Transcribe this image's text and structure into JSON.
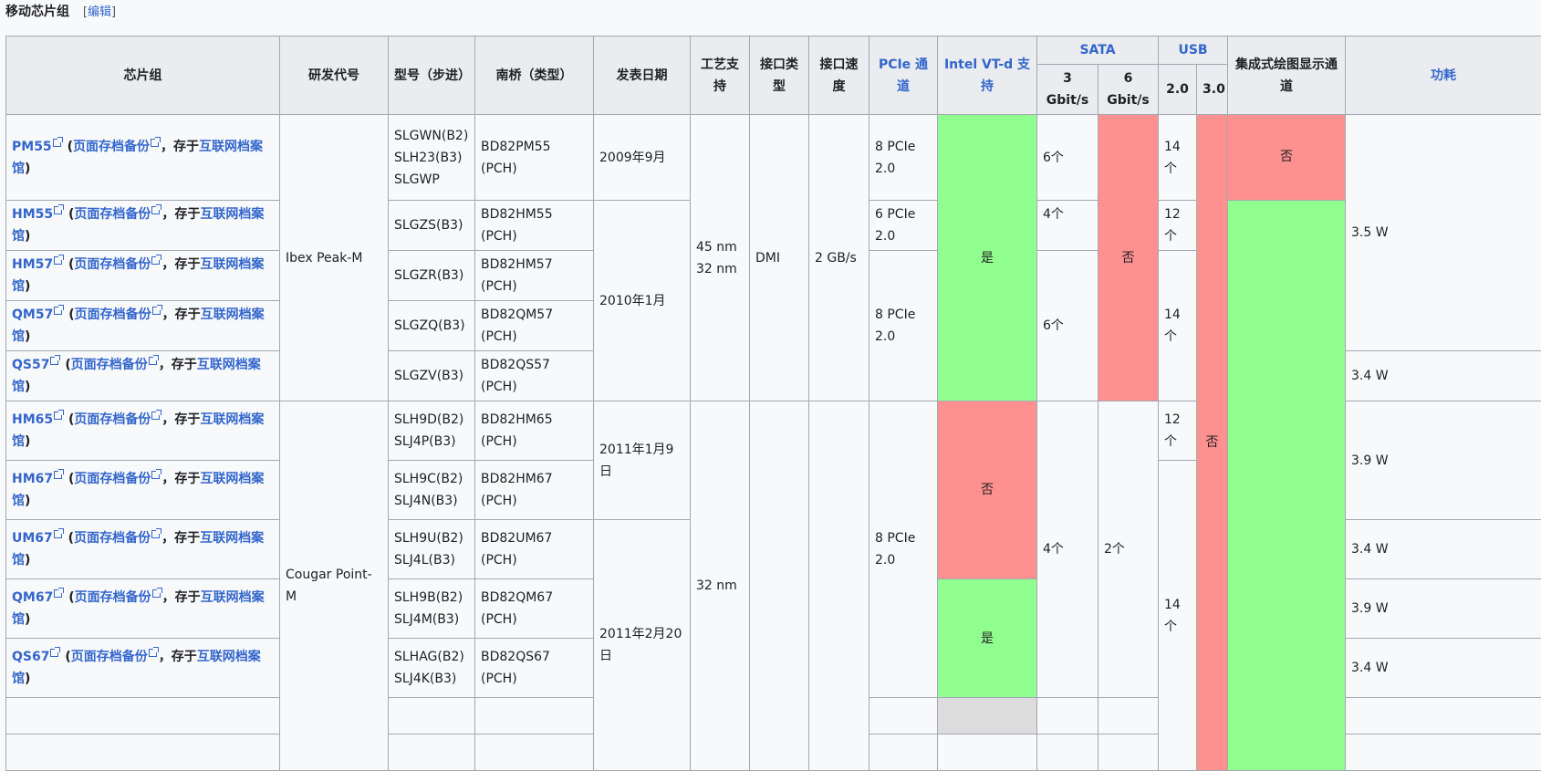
{
  "section": {
    "title": "移动芯片组",
    "edit_open": "[",
    "edit_label": "编辑",
    "edit_close": "]"
  },
  "headers": {
    "chipset": "芯片组",
    "codename": "研发代号",
    "model": "型号（步进）",
    "southbridge": "南桥（类型）",
    "date": "发表日期",
    "process": "工艺支持",
    "interface": "接口类型",
    "speed": "接口速度",
    "pcie": "PCIe 通道",
    "vtd": "Intel VT-d 支持",
    "sata": "SATA",
    "usb": "USB",
    "igp": "集成式绘图显示通道",
    "tdp": "功耗",
    "sata3": "3 Gbit/s",
    "sata6": "6 Gbit/s",
    "usb2": "2.0",
    "usb3": "3.0"
  },
  "common": {
    "archive": "页面存档备份",
    "sep": "，存于",
    "archive2": "互联网档案馆",
    "open": "(",
    "close": ")"
  },
  "rows": [
    {
      "name": "PM55",
      "steps": [
        "SLGWN(B2)",
        "SLH23(B3)",
        "SLGWP"
      ],
      "sb": "BD82PM55 (PCH)"
    },
    {
      "name": "HM55",
      "steps": [
        "SLGZS(B3)"
      ],
      "sb": "BD82HM55 (PCH)"
    },
    {
      "name": "HM57",
      "steps": [
        "SLGZR(B3)"
      ],
      "sb": "BD82HM57 (PCH)"
    },
    {
      "name": "QM57",
      "steps": [
        "SLGZQ(B3)"
      ],
      "sb": "BD82QM57 (PCH)"
    },
    {
      "name": "QS57",
      "steps": [
        "SLGZV(B3)"
      ],
      "sb": "BD82QS57 (PCH)"
    },
    {
      "name": "HM65",
      "steps": [
        "SLH9D(B2)",
        "SLJ4P(B3)"
      ],
      "sb": "BD82HM65 (PCH)"
    },
    {
      "name": "HM67",
      "steps": [
        "SLH9C(B2)",
        "SLJ4N(B3)"
      ],
      "sb": "BD82HM67 (PCH)"
    },
    {
      "name": "UM67",
      "steps": [
        "SLH9U(B2)",
        "SLJ4L(B3)"
      ],
      "sb": "BD82UM67 (PCH)"
    },
    {
      "name": "QM67",
      "steps": [
        "SLH9B(B2)",
        "SLJ4M(B3)"
      ],
      "sb": "BD82QM67 (PCH)"
    },
    {
      "name": "QS67",
      "steps": [
        "SLHAG(B2)",
        "SLJ4K(B3)"
      ],
      "sb": "BD82QS67 (PCH)"
    }
  ],
  "cells": {
    "ibex": "Ibex Peak-M",
    "cougar": "Cougar Point-M",
    "d2009": "2009年9月",
    "d2010": "2010年1月",
    "d2011a": "2011年1月9日",
    "d2011b": "2011年2月20日",
    "proc45": "45 nm",
    "proc32a": "32 nm",
    "proc32b": "32 nm",
    "dmi": "DMI",
    "gbs": "2 GB/s",
    "pcie8a": "8 PCIe 2.0",
    "pcie6": "6 PCIe 2.0",
    "pcie8b": "8 PCIe 2.0",
    "pcie8c": "8 PCIe 2.0",
    "yes": "是",
    "no": "否",
    "s6a": "6个",
    "s4a": "4个",
    "s6b": "6个",
    "s4b": "4个",
    "s2": "2个",
    "u14a": "14 个",
    "u12a": "12 个",
    "u14b": "14 个",
    "u12b": "12 个",
    "u14c": "14 个",
    "w35": "3.5 W",
    "w34a": "3.4 W",
    "w39a": "3.9 W",
    "w34b": "3.4 W",
    "w39b": "3.9 W",
    "w34c": "3.4 W"
  }
}
